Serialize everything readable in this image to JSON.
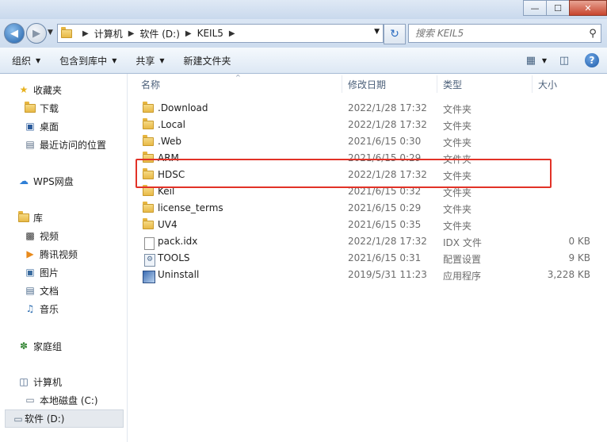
{
  "window": {
    "minimize_glyph": "—",
    "maximize_glyph": "☐",
    "close_glyph": "✕"
  },
  "address": {
    "segments": [
      "计算机",
      "软件 (D:)",
      "KEIL5"
    ]
  },
  "search": {
    "placeholder": "搜索 KEIL5"
  },
  "toolbar": {
    "organize": "组织",
    "include_in_library": "包含到库中",
    "share": "共享",
    "new_folder": "新建文件夹"
  },
  "nav": {
    "favorites": "收藏夹",
    "downloads": "下载",
    "desktop": "桌面",
    "recent": "最近访问的位置",
    "wps": "WPS网盘",
    "libraries": "库",
    "videos": "视频",
    "tencent_video": "腾讯视频",
    "pictures": "图片",
    "documents": "文档",
    "music": "音乐",
    "homegroup": "家庭组",
    "computer": "计算机",
    "local_disk": "本地磁盘 (C:)",
    "software_disk": "软件 (D:)"
  },
  "columns": {
    "name": "名称",
    "date_modified": "修改日期",
    "type": "类型",
    "size": "大小"
  },
  "files": [
    {
      "name": ".Download",
      "date": "2022/1/28 17:32",
      "type": "文件夹",
      "size": "",
      "icon": "folder-icon"
    },
    {
      "name": ".Local",
      "date": "2022/1/28 17:32",
      "type": "文件夹",
      "size": "",
      "icon": "folder-icon"
    },
    {
      "name": ".Web",
      "date": "2021/6/15 0:30",
      "type": "文件夹",
      "size": "",
      "icon": "folder-icon"
    },
    {
      "name": "ARM",
      "date": "2021/6/15 0:29",
      "type": "文件夹",
      "size": "",
      "icon": "folder-icon"
    },
    {
      "name": "HDSC",
      "date": "2022/1/28 17:32",
      "type": "文件夹",
      "size": "",
      "icon": "folder-icon"
    },
    {
      "name": "Keil",
      "date": "2021/6/15 0:32",
      "type": "文件夹",
      "size": "",
      "icon": "folder-icon"
    },
    {
      "name": "license_terms",
      "date": "2021/6/15 0:29",
      "type": "文件夹",
      "size": "",
      "icon": "folder-icon"
    },
    {
      "name": "UV4",
      "date": "2021/6/15 0:35",
      "type": "文件夹",
      "size": "",
      "icon": "folder-icon"
    },
    {
      "name": "pack.idx",
      "date": "2022/1/28 17:32",
      "type": "IDX 文件",
      "size": "0 KB",
      "icon": "file-icon"
    },
    {
      "name": "TOOLS",
      "date": "2021/6/15 0:31",
      "type": "配置设置",
      "size": "9 KB",
      "icon": "config-file-icon"
    },
    {
      "name": "Uninstall",
      "date": "2019/5/31 11:23",
      "type": "应用程序",
      "size": "3,228 KB",
      "icon": "application-icon"
    }
  ],
  "highlight_color": "#e23227"
}
